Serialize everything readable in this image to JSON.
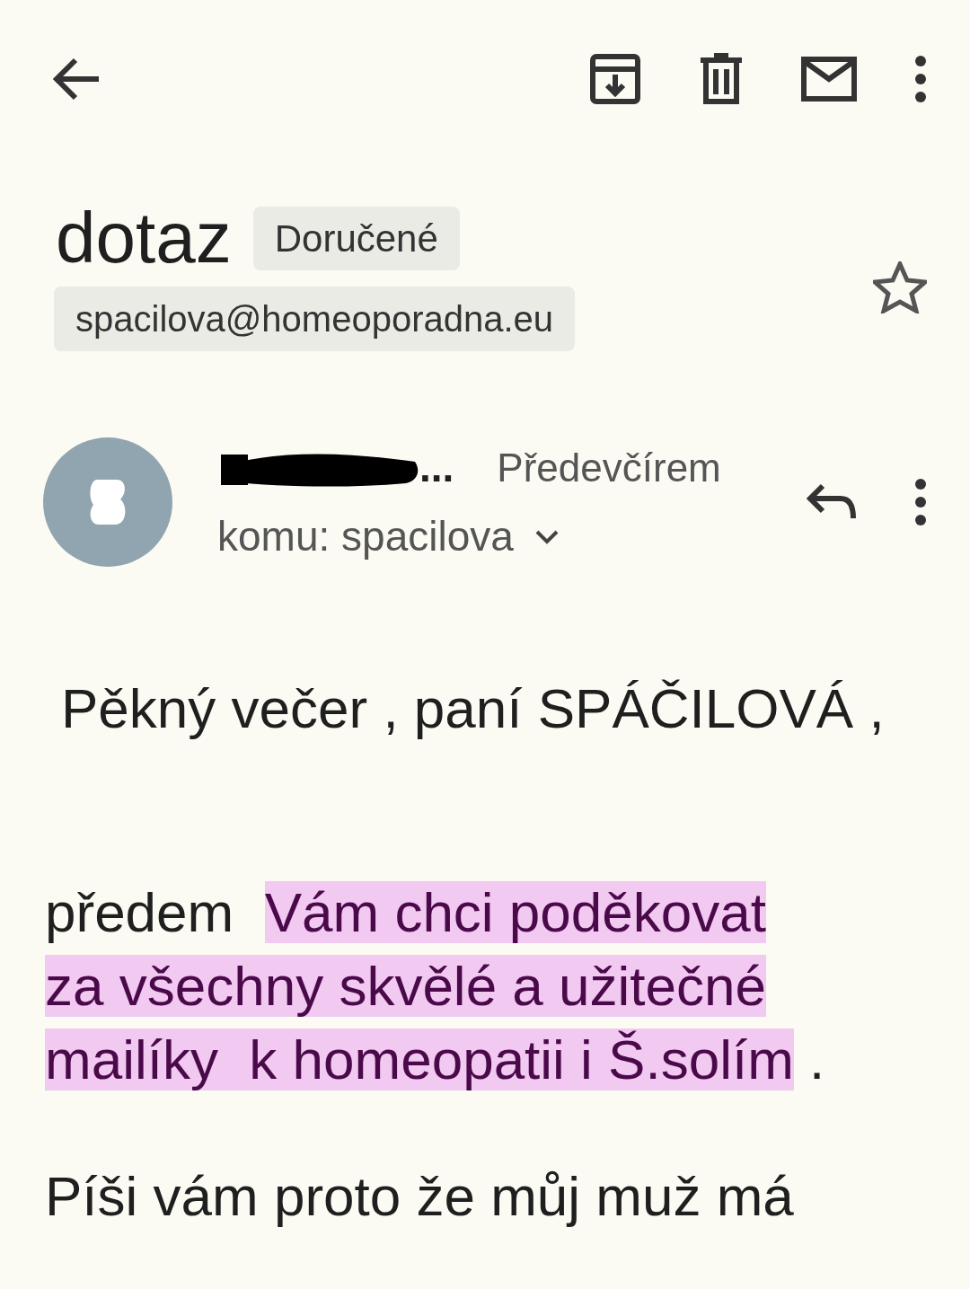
{
  "subject": "dotaz",
  "label": "Doručené",
  "starred": false,
  "address_chip": "spacilova@homeoporadna.eu",
  "sender": {
    "name": "...",
    "date": "Předevčírem",
    "to": "komu: spacilova"
  },
  "greeting": "Pěkný večer , paní SPÁČILOVÁ ,",
  "paragraphs": [
    {
      "lines": [
        [
          {
            "text": "předem  ",
            "highlighted": false
          },
          {
            "text": "Vám chci poděkovat",
            "highlighted": true
          }
        ],
        [
          {
            "text": "za všechny skvělé a užitečné",
            "highlighted": true
          }
        ],
        [
          {
            "text": "mailíky  k homeopatii i Š.solím",
            "highlighted": true
          },
          {
            "text": " .",
            "highlighted": false
          }
        ]
      ]
    },
    {
      "lines": [
        [
          {
            "text": "Píši vám proto že můj muž má",
            "highlighted": false
          }
        ]
      ]
    }
  ]
}
